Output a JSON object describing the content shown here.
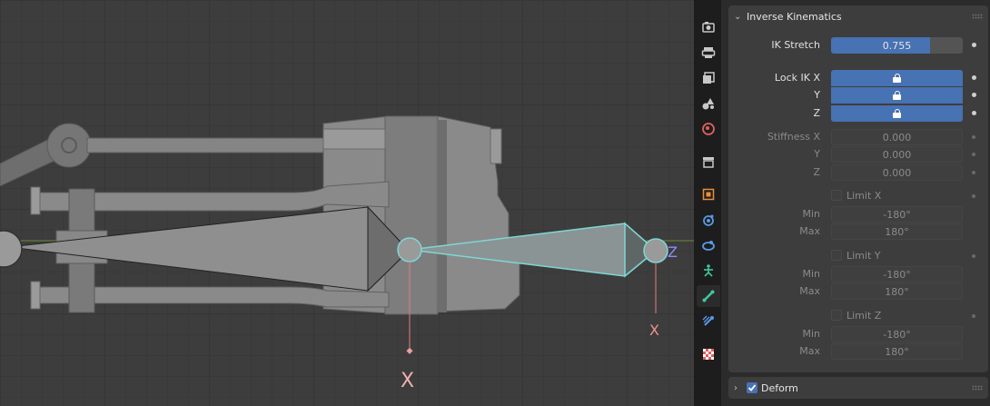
{
  "viewport": {
    "axis_x_label": "X",
    "axis_z_label": "Z",
    "colors": {
      "bone": "#8c8c8c",
      "bone_selected": "#7fd6d6",
      "x_axis": "#e57a7a",
      "green_axis": "#7ea33c"
    }
  },
  "tabs": [
    {
      "icon": "render-icon"
    },
    {
      "icon": "output-icon"
    },
    {
      "icon": "view-layer-icon"
    },
    {
      "icon": "scene-icon"
    },
    {
      "icon": "world-icon"
    },
    {
      "icon": "collection-icon"
    },
    {
      "icon": "object-icon"
    },
    {
      "icon": "modifiers-icon"
    },
    {
      "icon": "physics-icon"
    },
    {
      "icon": "object-data-armature-icon"
    },
    {
      "icon": "bone-icon",
      "active": true
    },
    {
      "icon": "bone-constraints-icon"
    },
    {
      "icon": "texture-icon"
    }
  ],
  "ik_panel": {
    "title": "Inverse Kinematics",
    "ik_stretch": {
      "label": "IK Stretch",
      "value": "0.755",
      "fraction": 0.755
    },
    "lock_x_label": "Lock IK X",
    "lock_y_label": "Y",
    "lock_z_label": "Z",
    "stiffness_x_label": "Stiffness X",
    "stiffness_x": "0.000",
    "stiffness_y_label": "Y",
    "stiffness_y": "0.000",
    "stiffness_z_label": "Z",
    "stiffness_z": "0.000",
    "limit_x_label": "Limit X",
    "limit_x_min_label": "Min",
    "limit_x_min": "-180°",
    "limit_x_max_label": "Max",
    "limit_x_max": "180°",
    "limit_y_label": "Limit Y",
    "limit_y_min_label": "Min",
    "limit_y_min": "-180°",
    "limit_y_max_label": "Max",
    "limit_y_max": "180°",
    "limit_z_label": "Limit Z",
    "limit_z_min_label": "Min",
    "limit_z_min": "-180°",
    "limit_z_max_label": "Max",
    "limit_z_max": "180°"
  },
  "deform_panel": {
    "title": "Deform",
    "enabled": true
  },
  "accent": "#4772b3"
}
